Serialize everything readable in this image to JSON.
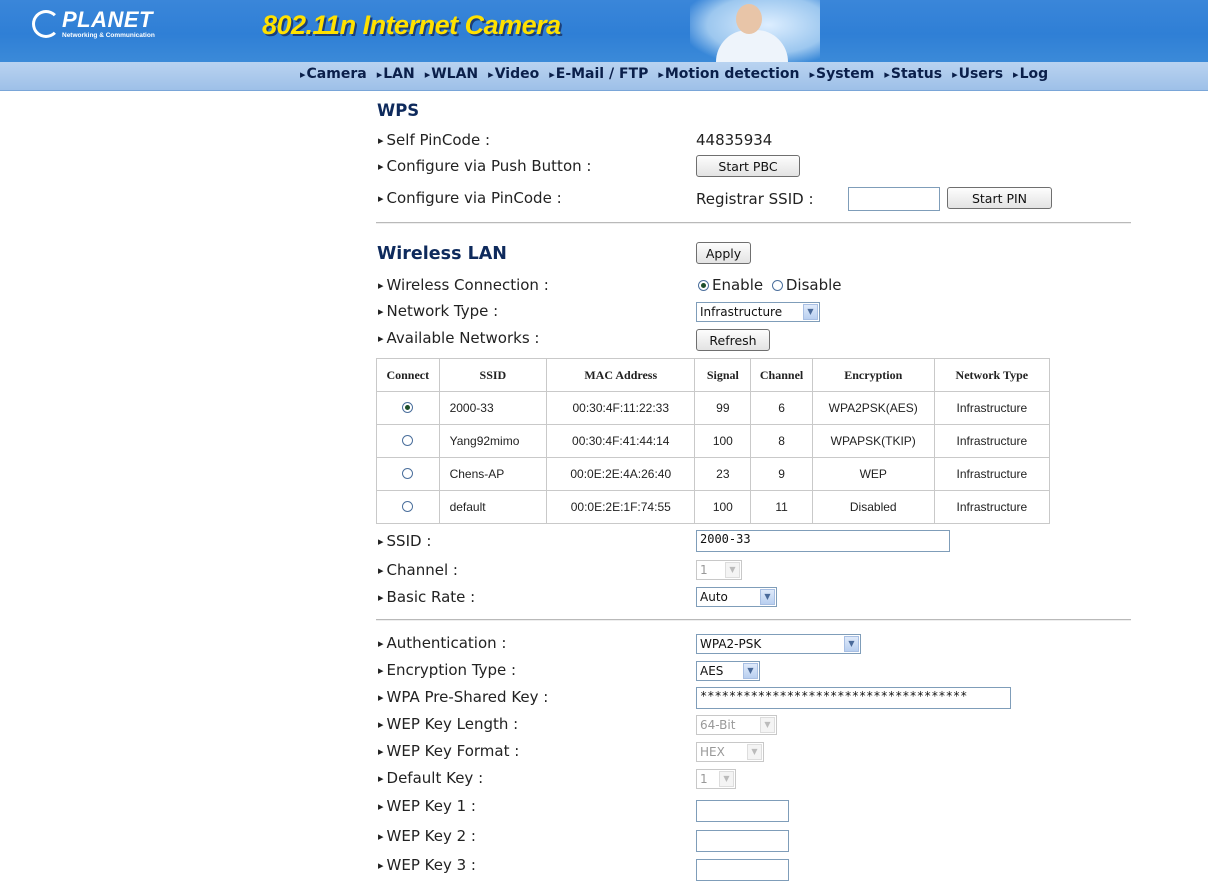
{
  "header": {
    "brand": "PLANET",
    "brand_tagline": "Networking & Communication",
    "product_title": "802.11n Internet Camera",
    "nav": [
      "Camera",
      "LAN",
      "WLAN",
      "Video",
      "E-Mail / FTP",
      "Motion detection",
      "System",
      "Status",
      "Users",
      "Log"
    ]
  },
  "wps": {
    "title": "WPS",
    "self_pincode_label": "Self PinCode :",
    "self_pincode_value": "44835934",
    "push_button_label": "Configure via Push Button :",
    "start_pbc": "Start PBC",
    "pincode_label": "Configure via PinCode :",
    "registrar_ssid_label": "Registrar SSID :",
    "registrar_ssid_value": "",
    "start_pin": "Start PIN"
  },
  "wlan": {
    "title": "Wireless LAN",
    "apply": "Apply",
    "connection_label": "Wireless Connection :",
    "enable_label": "Enable",
    "disable_label": "Disable",
    "connection_selected": "Enable",
    "network_type_label": "Network Type :",
    "network_type_value": "Infrastructure",
    "available_label": "Available Networks :",
    "refresh": "Refresh",
    "table": {
      "headers": [
        "Connect",
        "SSID",
        "MAC Address",
        "Signal",
        "Channel",
        "Encryption",
        "Network Type"
      ],
      "rows": [
        {
          "selected": true,
          "ssid": "2000-33",
          "mac": "00:30:4F:11:22:33",
          "signal": "99",
          "channel": "6",
          "enc": "WPA2PSK(AES)",
          "type": "Infrastructure"
        },
        {
          "selected": false,
          "ssid": "Yang92mimo",
          "mac": "00:30:4F:41:44:14",
          "signal": "100",
          "channel": "8",
          "enc": "WPAPSK(TKIP)",
          "type": "Infrastructure"
        },
        {
          "selected": false,
          "ssid": "Chens-AP",
          "mac": "00:0E:2E:4A:26:40",
          "signal": "23",
          "channel": "9",
          "enc": "WEP",
          "type": "Infrastructure"
        },
        {
          "selected": false,
          "ssid": "default",
          "mac": "00:0E:2E:1F:74:55",
          "signal": "100",
          "channel": "11",
          "enc": "Disabled",
          "type": "Infrastructure"
        }
      ]
    },
    "ssid_label": "SSID :",
    "ssid_value": "2000-33",
    "channel_label": "Channel :",
    "channel_value": "1",
    "basic_rate_label": "Basic Rate :",
    "basic_rate_value": "Auto"
  },
  "security": {
    "auth_label": "Authentication :",
    "auth_value": "WPA2-PSK",
    "enc_type_label": "Encryption Type :",
    "enc_type_value": "AES",
    "psk_label": "WPA Pre-Shared Key :",
    "psk_value": "*************************************",
    "wep_len_label": "WEP Key Length :",
    "wep_len_value": "64-Bit",
    "wep_format_label": "WEP Key Format :",
    "wep_format_value": "HEX",
    "default_key_label": "Default Key :",
    "default_key_value": "1",
    "wep_key1_label": "WEP Key 1 :",
    "wep_key2_label": "WEP Key 2 :",
    "wep_key3_label": "WEP Key 3 :",
    "wep_key1_value": "",
    "wep_key2_value": "",
    "wep_key3_value": ""
  }
}
